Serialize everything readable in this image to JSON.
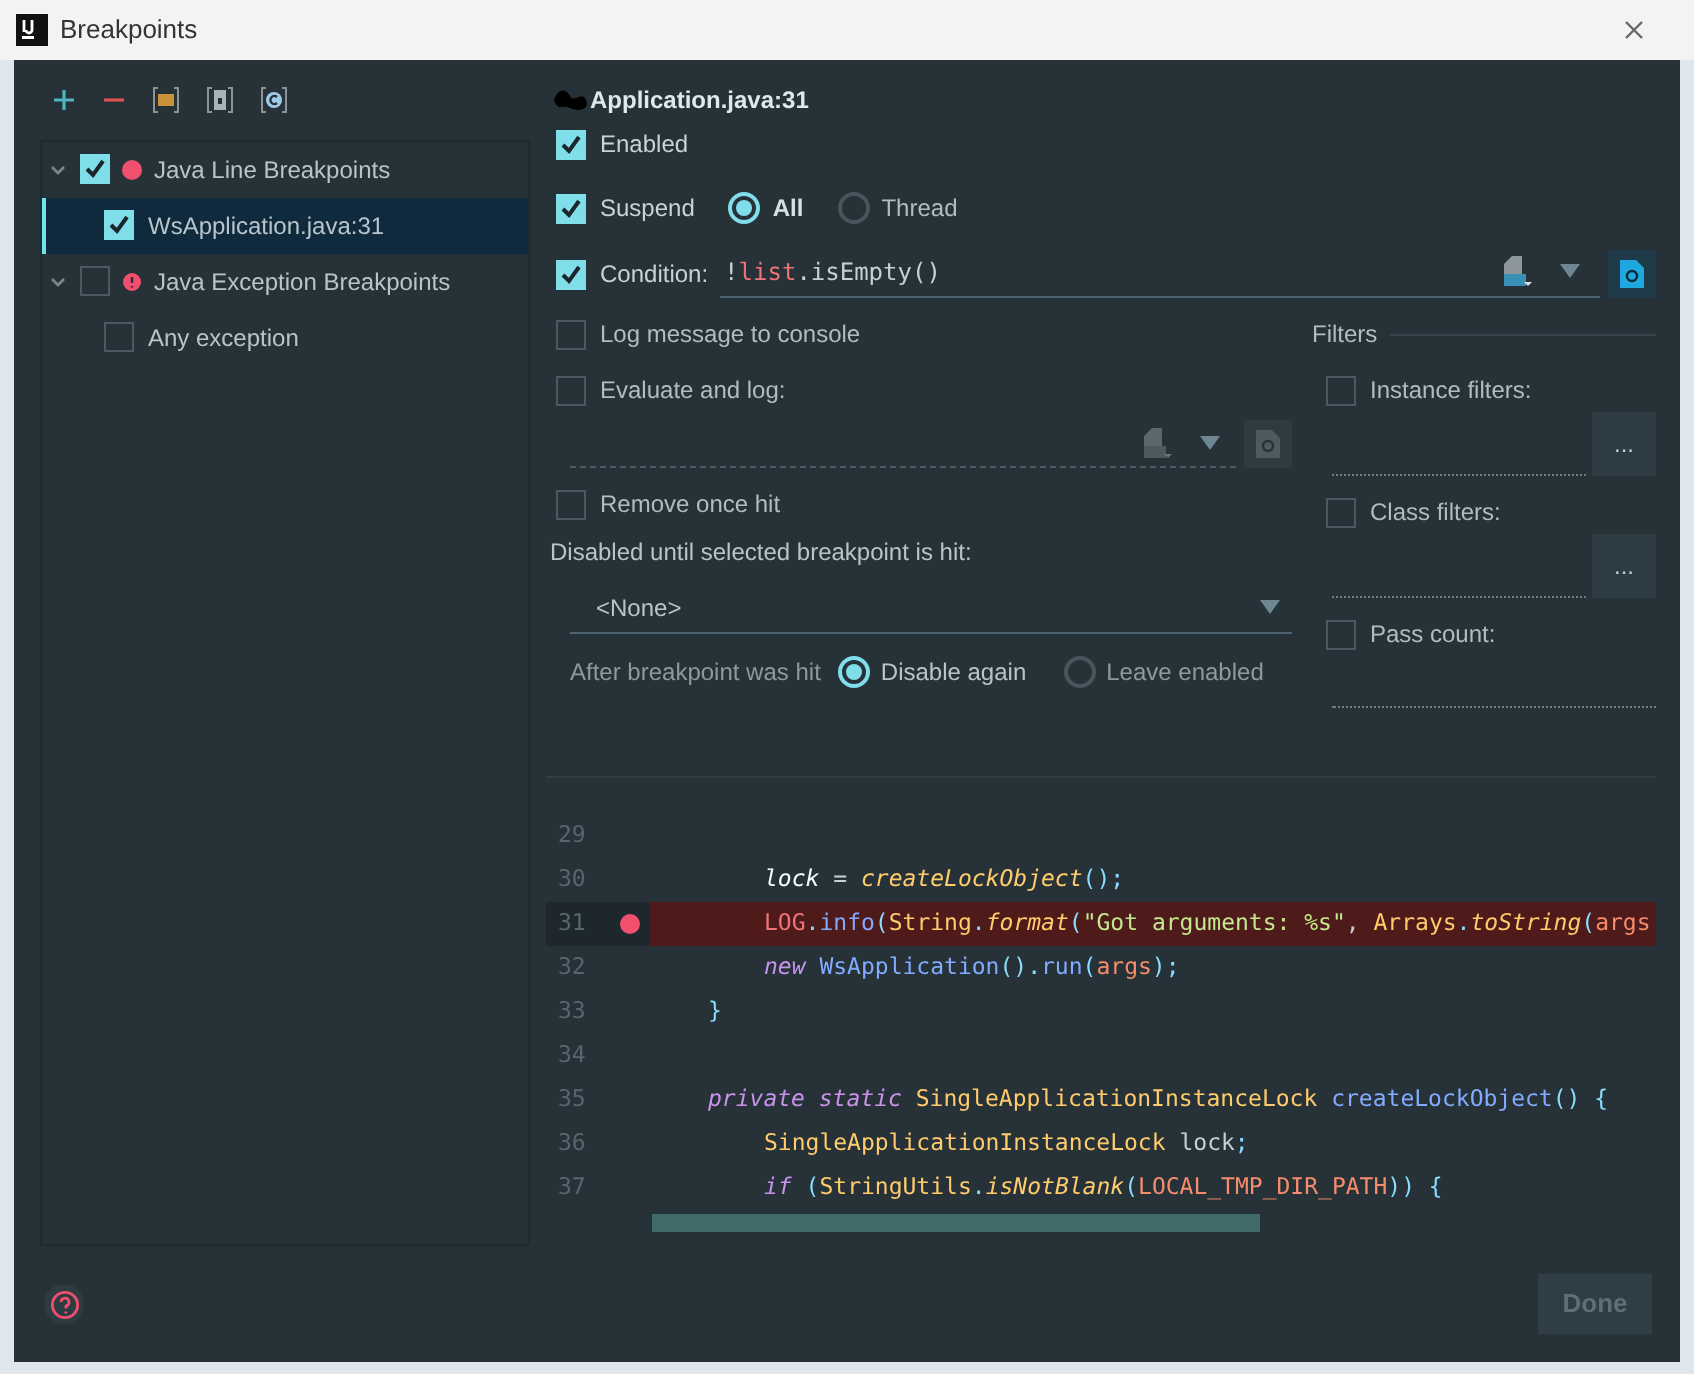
{
  "window": {
    "title": "Breakpoints"
  },
  "toolbar": [
    {
      "kind": "add"
    },
    {
      "kind": "remove"
    },
    {
      "kind": "folder"
    },
    {
      "kind": "file"
    },
    {
      "kind": "class"
    }
  ],
  "tree": [
    {
      "label": "Java Line Breakpoints",
      "checked": true,
      "expanded": true,
      "selected": false,
      "kind": "line",
      "color": "#f0506e",
      "children": [
        {
          "label": "WsApplication.java:31",
          "checked": true,
          "selected": true
        }
      ]
    },
    {
      "label": "Java Exception Breakpoints",
      "checked": false,
      "expanded": true,
      "selected": false,
      "kind": "exception",
      "color": "#f0506e",
      "children": [
        {
          "label": "Any exception",
          "checked": false,
          "selected": false
        }
      ]
    }
  ],
  "details": {
    "title": "Application.java:31",
    "enabled": {
      "label": "Enabled",
      "checked": true
    },
    "suspend": {
      "label": "Suspend",
      "checked": true,
      "options": [
        {
          "label": "All",
          "selected": true
        },
        {
          "label": "Thread",
          "selected": false
        }
      ]
    },
    "condition": {
      "label": "Condition:",
      "checked": true,
      "value": [
        {
          "text": "!",
          "kind": "plain"
        },
        {
          "text": "list",
          "kind": "field"
        },
        {
          "text": ".isEmpty()",
          "kind": "plain"
        }
      ]
    },
    "log_message": {
      "label": "Log message to console",
      "checked": false
    },
    "evaluate": {
      "label": "Evaluate and log:",
      "checked": false
    },
    "remove_once": {
      "label": "Remove once hit",
      "checked": false
    },
    "disabled_until": {
      "label": "Disabled until selected breakpoint is hit:",
      "value": "<None>"
    },
    "after_hit": {
      "label": "After breakpoint was hit",
      "options": [
        {
          "label": "Disable again",
          "selected": true
        },
        {
          "label": "Leave enabled",
          "selected": false
        }
      ]
    },
    "filters": {
      "title": "Filters",
      "items": [
        {
          "label": "Instance filters:",
          "checked": false,
          "button": "..."
        },
        {
          "label": "Class filters:",
          "checked": false,
          "button": "..."
        },
        {
          "label": "Pass count:",
          "checked": false
        }
      ]
    }
  },
  "code": {
    "lines": [
      {
        "number": "29",
        "breakpoint": false
      },
      {
        "number": "30",
        "breakpoint": false,
        "kind": "statement",
        "tokens": [
          {
            "text": "lock",
            "kind": "local"
          },
          {
            "text": " = ",
            "kind": "plain"
          },
          {
            "text": "createLockObject",
            "kind": "static"
          },
          {
            "text": "();",
            "kind": "punct"
          }
        ]
      },
      {
        "number": "31",
        "breakpoint": true,
        "kind": "statement",
        "tokens": [
          {
            "text": "LOG",
            "kind": "field"
          },
          {
            "text": ".",
            "kind": "punct"
          },
          {
            "text": "info",
            "kind": "method"
          },
          {
            "text": "(",
            "kind": "punct"
          },
          {
            "text": "String",
            "kind": "type"
          },
          {
            "text": ".",
            "kind": "punct"
          },
          {
            "text": "format",
            "kind": "static"
          },
          {
            "text": "(",
            "kind": "punct"
          },
          {
            "text": "\"Got arguments: %s\"",
            "kind": "string"
          },
          {
            "text": ", ",
            "kind": "plain"
          },
          {
            "text": "Arrays",
            "kind": "type"
          },
          {
            "text": ".",
            "kind": "punct"
          },
          {
            "text": "toString",
            "kind": "static"
          },
          {
            "text": "(",
            "kind": "punct"
          },
          {
            "text": "args",
            "kind": "param"
          }
        ]
      },
      {
        "number": "32",
        "breakpoint": false,
        "kind": "statement",
        "tokens": [
          {
            "text": "new",
            "kind": "keyword"
          },
          {
            "text": " WsApplication",
            "kind": "method"
          },
          {
            "text": "().",
            "kind": "punct"
          },
          {
            "text": "run",
            "kind": "method"
          },
          {
            "text": "(",
            "kind": "punct"
          },
          {
            "text": "args",
            "kind": "param"
          },
          {
            "text": ");",
            "kind": "punct"
          }
        ]
      },
      {
        "number": "33",
        "breakpoint": false,
        "kind": "member",
        "tokens": [
          {
            "text": "}",
            "kind": "punct"
          }
        ]
      },
      {
        "number": "34",
        "breakpoint": false
      },
      {
        "number": "35",
        "breakpoint": false,
        "kind": "member",
        "tokens": [
          {
            "text": "private static",
            "kind": "keyword"
          },
          {
            "text": " SingleApplicationInstanceLock ",
            "kind": "type"
          },
          {
            "text": "createLockObject",
            "kind": "method"
          },
          {
            "text": "() {",
            "kind": "punct"
          }
        ]
      },
      {
        "number": "36",
        "breakpoint": false,
        "kind": "statement",
        "tokens": [
          {
            "text": "SingleApplicationInstanceLock",
            "kind": "type"
          },
          {
            "text": " lock",
            "kind": "plain"
          },
          {
            "text": ";",
            "kind": "punct"
          }
        ]
      },
      {
        "number": "37",
        "breakpoint": false,
        "kind": "statement",
        "tokens": [
          {
            "text": "if",
            "kind": "keyword"
          },
          {
            "text": " (",
            "kind": "punct"
          },
          {
            "text": "StringUtils",
            "kind": "type"
          },
          {
            "text": ".",
            "kind": "punct"
          },
          {
            "text": "isNotBlank",
            "kind": "static"
          },
          {
            "text": "(",
            "kind": "punct"
          },
          {
            "text": "LOCAL_TMP_DIR_PATH",
            "kind": "param"
          },
          {
            "text": ")) {",
            "kind": "punct"
          }
        ]
      }
    ]
  },
  "footer": {
    "done": {
      "label": "Done",
      "disabled": true
    }
  }
}
